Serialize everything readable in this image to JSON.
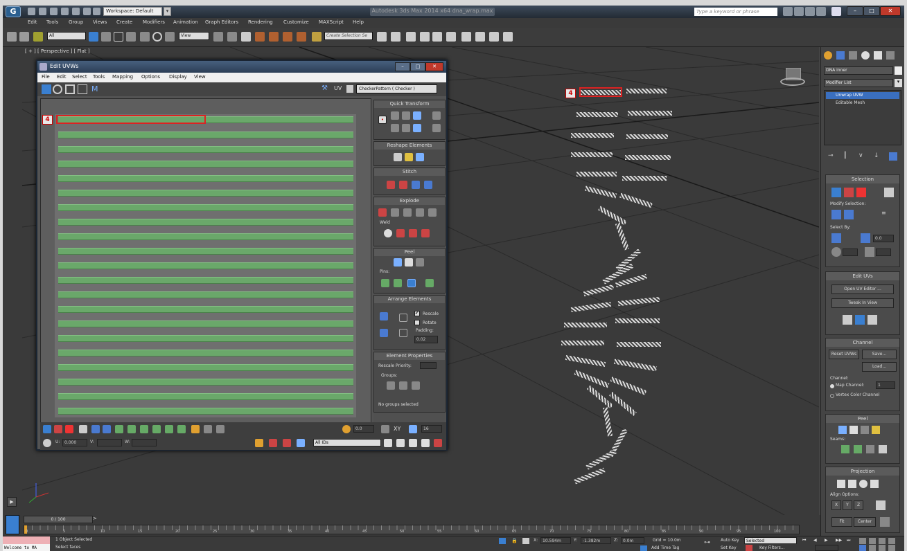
{
  "titlebar": {
    "workspace_label": "Workspace: Default",
    "app_title": "Autodesk 3ds Max 2014 x64   dna_wrap.max",
    "search_placeholder": "Type a keyword or phrase"
  },
  "menubar": [
    "Edit",
    "Tools",
    "Group",
    "Views",
    "Create",
    "Modifiers",
    "Animation",
    "Graph Editors",
    "Rendering",
    "Customize",
    "MAXScript",
    "Help"
  ],
  "toolbar": {
    "filter_value": "All",
    "refcoord_value": "View",
    "selset_placeholder": "Create Selection Se"
  },
  "viewport": {
    "label": "[ + ] [ Perspective ] [ Flat ]"
  },
  "uv_editor": {
    "title": "Edit UVWs",
    "menu": [
      "File",
      "Edit",
      "Select",
      "Tools",
      "Mapping",
      "Options",
      "Display",
      "View"
    ],
    "uv_label": "UV",
    "texture_dropdown": "CheckerPattern  ( Checker )",
    "sections": {
      "quick_transform": "Quick Transform",
      "reshape": "Reshape Elements",
      "stitch": "Stitch",
      "explode": "Explode",
      "weld": "Weld",
      "peel": "Peel",
      "pins": "Pins:",
      "arrange": "Arrange Elements",
      "rescale": "Rescale",
      "rotate": "Rotate",
      "padding": "Padding:",
      "padding_value": "0.02",
      "element_props": "Element Properties",
      "rescale_priority": "Rescale Priority:",
      "groups": "Groups:",
      "no_groups": "No groups selected"
    },
    "bottom": {
      "u": "U:",
      "u_value": "0.000",
      "v": "V:",
      "w": "W:",
      "xy_label": "XY",
      "ids": "All IDs",
      "value1": "0.0",
      "value2": "16"
    },
    "tag": "4"
  },
  "viewport_tag": "4",
  "command_panel": {
    "object_name": "DNA inner",
    "modifier_list": "Modifier List",
    "stack": [
      "Unwrap UVW",
      "Editable Mesh"
    ],
    "selection_header": "Selection",
    "modify_selection": "Modify Selection:",
    "select_by": "Select By:",
    "select_value": "0.0",
    "edit_uvs_header": "Edit UVs",
    "open_uv_editor": "Open UV Editor ...",
    "tweak_in_view": "Tweak In View",
    "channel_header": "Channel",
    "reset_uvws": "Reset UVWs",
    "save": "Save...",
    "load": "Load...",
    "channel_label": "Channel:",
    "map_channel": "Map Channel:",
    "map_channel_value": "1",
    "vertex_color": "Vertex Color Channel",
    "peel_header": "Peel",
    "seams": "Seams:",
    "projection_header": "Projection",
    "align_options": "Align Options:",
    "align_x": "X",
    "align_y": "Y",
    "align_z": "Z",
    "fit": "Fit",
    "center": "Center"
  },
  "timeline": {
    "frame": "0 / 100",
    "ticks": [
      "0",
      "5",
      "10",
      "15",
      "20",
      "25",
      "30",
      "35",
      "40",
      "45",
      "50",
      "55",
      "60",
      "65",
      "70",
      "75",
      "80",
      "85",
      "90",
      "95",
      "100"
    ]
  },
  "status": {
    "listener": "Welcome to MA",
    "selected": "1 Object Selected",
    "prompt": "Select faces",
    "x_label": "X:",
    "x_value": "10.594m",
    "y_label": "Y:",
    "y_value": "-1.382m",
    "z_label": "Z:",
    "z_value": "0.0m",
    "grid": "Grid = 10.0m",
    "add_time_tag": "Add Time Tag",
    "auto_key": "Auto Key",
    "auto_key_mode": "Selected",
    "set_key": "Set Key",
    "key_filters": "Key Filters..."
  },
  "colors": {
    "uv_green": "#6aa86a",
    "selection_red": "#d22222",
    "title_blue": "#3b5372"
  }
}
